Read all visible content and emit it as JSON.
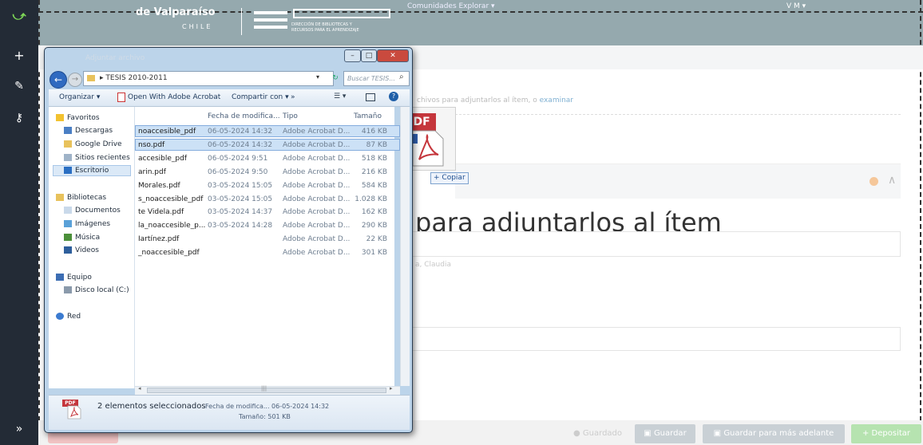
{
  "app": {
    "brand_uv": "de Valparaíso",
    "brand_chile": "CHILE",
    "brand_sub1": "DIRECCIÓN DE BIBLIOTECAS Y",
    "brand_sub2": "RECURSOS PARA EL APRENDIZAJE",
    "nav_links": "Comunidades   Explorar ▾",
    "nav_user": "V  M ▾",
    "drop_text": "chivos para adjuntarlos al ítem, o",
    "drop_link": "examinar",
    "heading": "para adjuntarlos al ítem",
    "author": "a, Claudia",
    "status_saved": "Guardado",
    "btn_save": "Guardar",
    "btn_save_later": "Guardar para más adelante",
    "btn_deposit": "+ Depositar",
    "accent_green": "#b6e3b0",
    "rail_icons": [
      "app-logo-icon",
      "plus-icon",
      "pencil-icon",
      "key-icon",
      "double-chevron-right-icon"
    ]
  },
  "drag": {
    "tag": "PDF",
    "copy_label": "Copiar"
  },
  "explorer": {
    "title": "Adjuntar archivo",
    "address": "TESIS 2010-2011",
    "search_placeholder": "Buscar TESIS...",
    "toolbar": {
      "organize": "Organizar ▾",
      "open_with": "Open With Adobe Acrobat",
      "share": "Compartir con ▾",
      "more": "»"
    },
    "nav": {
      "favorites": "Favoritos",
      "downloads": "Descargas",
      "google_drive": "Google Drive",
      "recent": "Sitios recientes",
      "desktop": "Escritorio",
      "libraries": "Bibliotecas",
      "documents": "Documentos",
      "images": "Imágenes",
      "music": "Música",
      "videos": "Videos",
      "computer": "Equipo",
      "local_disk": "Disco local (C:)",
      "network": "Red"
    },
    "columns": {
      "date": "Fecha de modifica...",
      "type": "Tipo",
      "size": "Tamaño"
    },
    "files": [
      {
        "name": "noaccesible_pdf",
        "date": "06-05-2024 14:32",
        "type": "Adobe Acrobat D...",
        "size": "416 KB",
        "selected": true
      },
      {
        "name": "nso.pdf",
        "date": "06-05-2024 14:32",
        "type": "Adobe Acrobat D...",
        "size": "87 KB",
        "selected": true
      },
      {
        "name": "accesible_pdf",
        "date": "06-05-2024 9:51",
        "type": "Adobe Acrobat D...",
        "size": "518 KB",
        "selected": false
      },
      {
        "name": "arin.pdf",
        "date": "06-05-2024 9:50",
        "type": "Adobe Acrobat D...",
        "size": "216 KB",
        "selected": false
      },
      {
        "name": "Morales.pdf",
        "date": "03-05-2024 15:05",
        "type": "Adobe Acrobat D...",
        "size": "584 KB",
        "selected": false
      },
      {
        "name": "s_noaccesible_pdf",
        "date": "03-05-2024 15:05",
        "type": "Adobe Acrobat D...",
        "size": "1.028 KB",
        "selected": false
      },
      {
        "name": "te Videla.pdf",
        "date": "03-05-2024 14:37",
        "type": "Adobe Acrobat D...",
        "size": "162 KB",
        "selected": false
      },
      {
        "name": "la_noaccesible_p...",
        "date": "03-05-2024 14:28",
        "type": "Adobe Acrobat D...",
        "size": "290 KB",
        "selected": false
      },
      {
        "name": "Iartínez.pdf",
        "date": "",
        "type": "Adobe Acrobat D...",
        "size": "22 KB",
        "selected": false
      },
      {
        "name": "_noaccesible_pdf",
        "date": "",
        "type": "Adobe Acrobat D...",
        "size": "301 KB",
        "selected": false
      }
    ],
    "details": {
      "tag": "PDF",
      "count": "2 elementos seleccionados",
      "date": "Fecha de modifica... 06-05-2024 14:32",
      "size": "Tamaño: 501 KB"
    }
  }
}
